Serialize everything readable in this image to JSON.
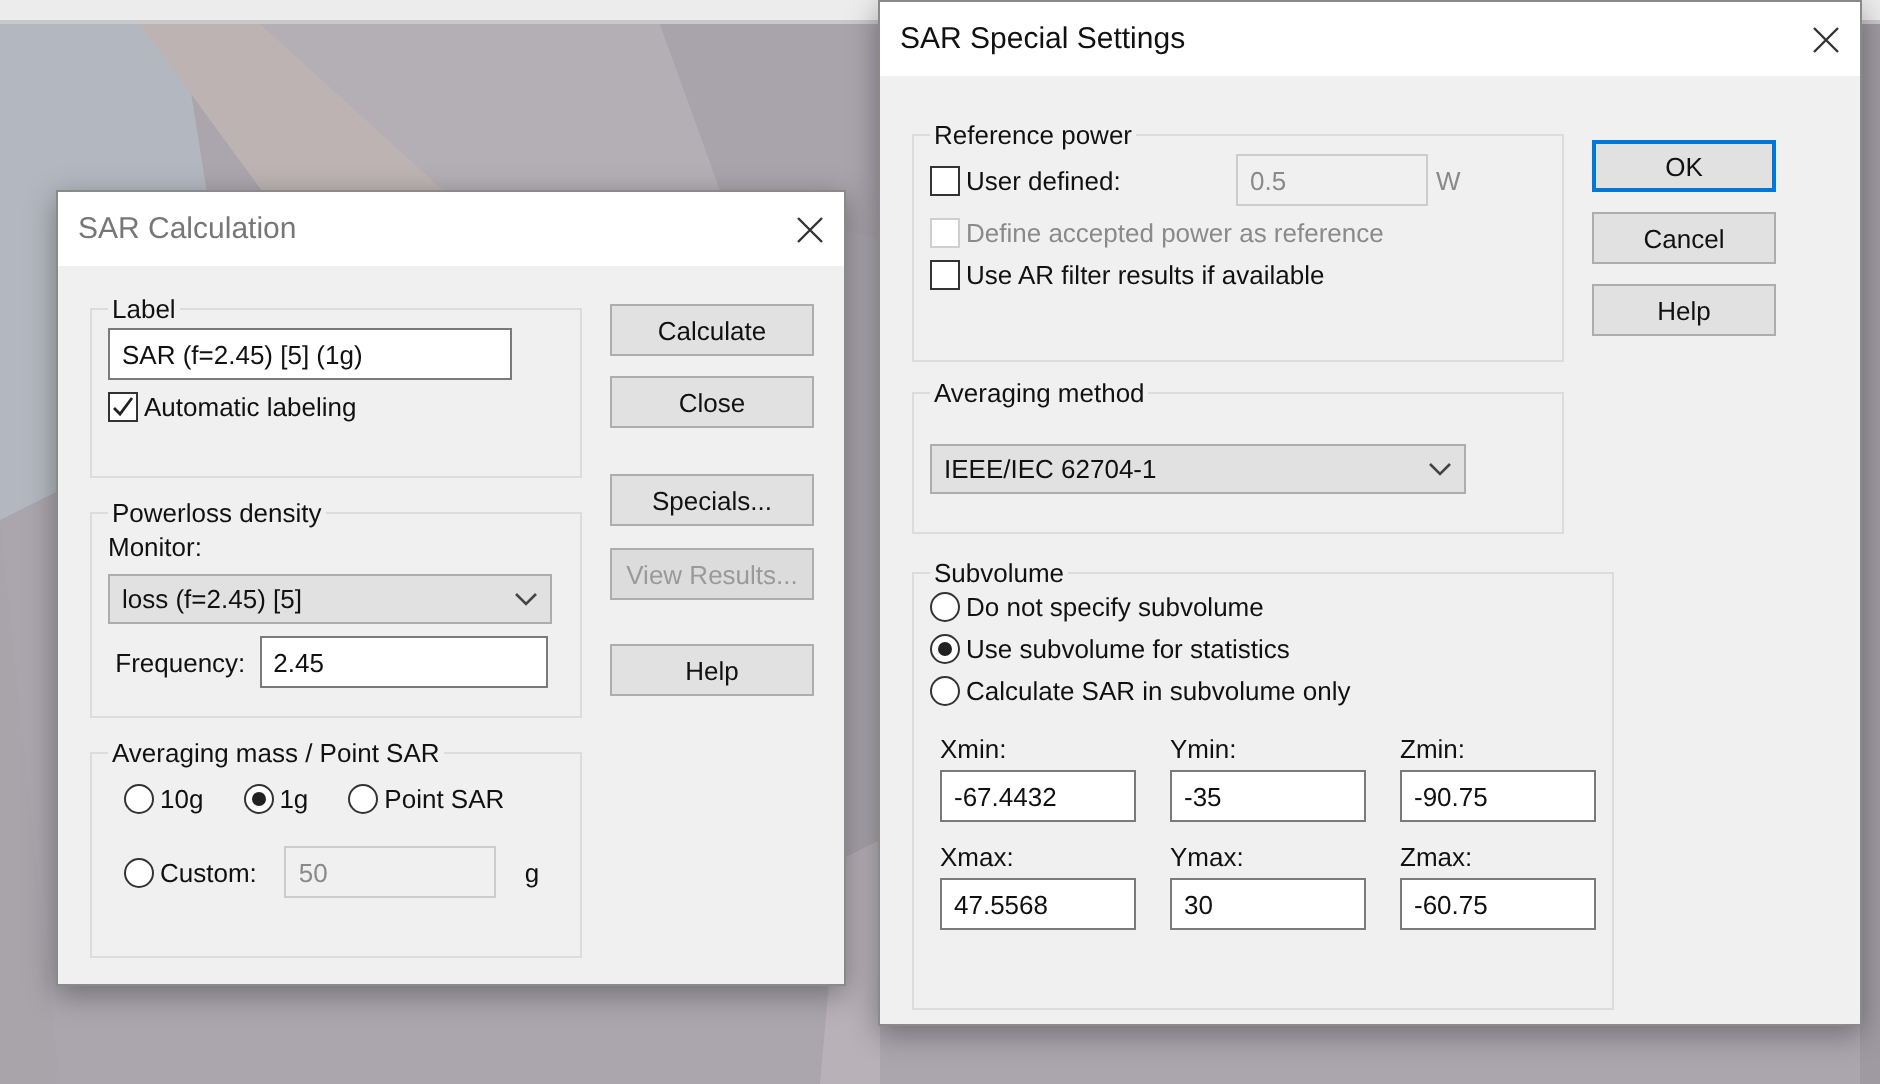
{
  "sar_calculation": {
    "title": "SAR Calculation",
    "label_group": {
      "title": "Label",
      "value": "SAR (f=2.45) [5] (1g)",
      "automatic_labeling": {
        "label": "Automatic labeling",
        "checked": true
      }
    },
    "powerloss_group": {
      "title": "Powerloss density",
      "monitor_label": "Monitor:",
      "monitor": "loss (f=2.45) [5]",
      "frequency_label": "Frequency:",
      "frequency": "2.45"
    },
    "averaging_group": {
      "title": "Averaging mass / Point SAR",
      "options": [
        {
          "label": "10g",
          "selected": false
        },
        {
          "label": "1g",
          "selected": true
        },
        {
          "label": "Point SAR",
          "selected": false
        },
        {
          "label": "Custom:",
          "selected": false
        }
      ],
      "custom_value": {
        "value": "50",
        "disabled": true
      },
      "custom_unit": "g"
    },
    "buttons": [
      {
        "label": "Calculate",
        "disabled": false
      },
      {
        "label": "Close",
        "disabled": false
      },
      {
        "label": "Specials...",
        "disabled": false
      },
      {
        "label": "View Results...",
        "disabled": true
      },
      {
        "label": "Help",
        "disabled": false
      }
    ]
  },
  "sar_special_settings": {
    "title": "SAR Special Settings",
    "reference_power": {
      "title": "Reference power",
      "user_defined": {
        "label": "User defined:",
        "checked": false
      },
      "power_value": {
        "value": "0.5",
        "disabled": true
      },
      "power_unit": "W",
      "define_accepted": {
        "label": "Define accepted power as reference",
        "checked": false,
        "disabled": true
      },
      "use_ar_filter": {
        "label": "Use AR filter results if available",
        "checked": false
      }
    },
    "averaging_method": {
      "title": "Averaging method",
      "value": "IEEE/IEC 62704-1"
    },
    "subvolume": {
      "title": "Subvolume",
      "options": [
        {
          "label": "Do not specify subvolume",
          "selected": false
        },
        {
          "label": "Use subvolume for statistics",
          "selected": true
        },
        {
          "label": "Calculate SAR in subvolume only",
          "selected": false
        }
      ],
      "fields": [
        {
          "label": "Xmin:",
          "value": "-67.4432"
        },
        {
          "label": "Ymin:",
          "value": "-35"
        },
        {
          "label": "Zmin:",
          "value": "-90.75"
        },
        {
          "label": "Xmax:",
          "value": "47.5568"
        },
        {
          "label": "Ymax:",
          "value": "30"
        },
        {
          "label": "Zmax:",
          "value": "-60.75"
        }
      ]
    },
    "buttons": [
      {
        "label": "OK",
        "default": true
      },
      {
        "label": "Cancel",
        "default": false
      },
      {
        "label": "Help",
        "default": false
      }
    ]
  }
}
